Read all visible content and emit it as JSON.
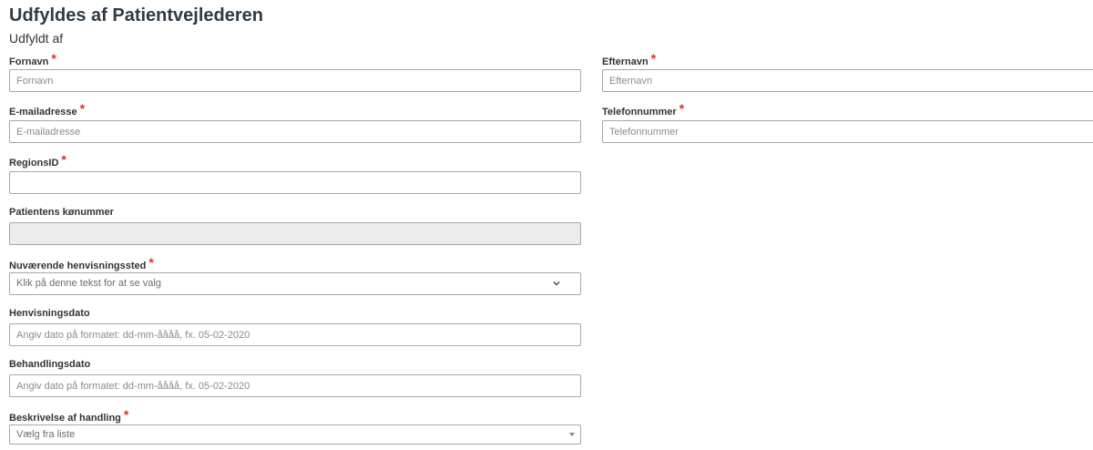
{
  "header": {
    "title": "Udfyldes af Patientvejlederen",
    "subtitle": "Udfyldt af"
  },
  "form": {
    "required_mark": "*",
    "fornavn": {
      "label": "Fornavn",
      "placeholder": "Fornavn",
      "value": ""
    },
    "efternavn": {
      "label": "Efternavn",
      "placeholder": "Efternavn",
      "value": ""
    },
    "email": {
      "label": "E-mailadresse",
      "placeholder": "E-mailadresse",
      "value": ""
    },
    "telefon": {
      "label": "Telefonnummer",
      "placeholder": "Telefonnummer",
      "value": ""
    },
    "regionsid": {
      "label": "RegionsID",
      "placeholder": "",
      "value": ""
    },
    "konummer": {
      "label": "Patientens kønummer",
      "placeholder": "",
      "value": ""
    },
    "henvisningssted": {
      "label": "Nuværende henvisningssted",
      "selected": "Klik på denne tekst for at se valg"
    },
    "henvisningsdato": {
      "label": "Henvisningsdato",
      "placeholder": "Angiv dato på formatet: dd-mm-åååå, fx. 05-02-2020",
      "value": ""
    },
    "behandlingsdato": {
      "label": "Behandlingsdato",
      "placeholder": "Angiv dato på formatet: dd-mm-åååå, fx. 05-02-2020",
      "value": ""
    },
    "beskrivelse": {
      "label": "Beskrivelse af handling",
      "selected": "Vælg fra liste"
    }
  },
  "colors": {
    "title": "#2f3a44",
    "required": "#d9322b",
    "border": "#a8a8a8",
    "disabled_bg": "#ececec"
  },
  "icons": {
    "henvisningssted_dropdown": "chevron-down-icon",
    "beskrivelse_dropdown": "caret-down-icon"
  }
}
